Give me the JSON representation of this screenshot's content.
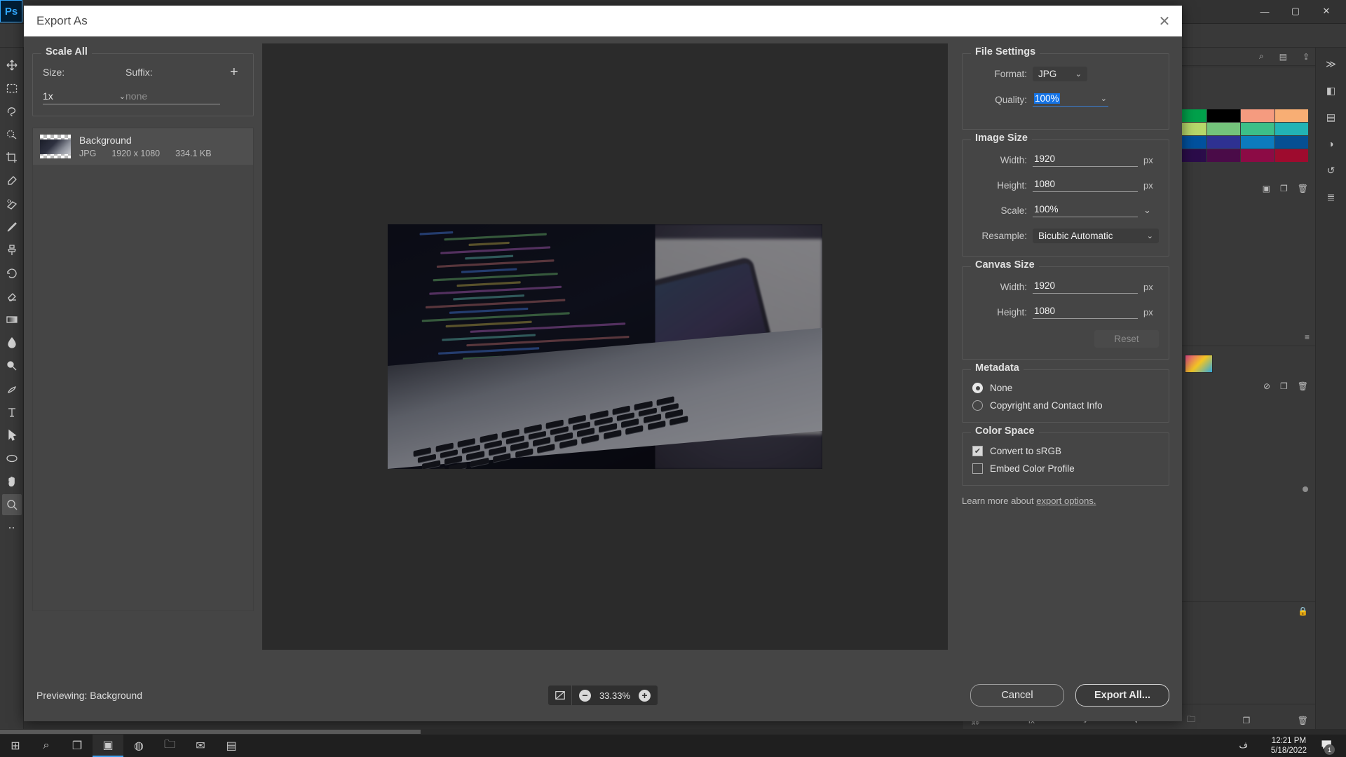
{
  "app": {
    "logo_text": "Ps",
    "window_controls": {
      "minimize": "—",
      "maximize": "▢",
      "close": "✕"
    }
  },
  "dialog": {
    "title": "Export As",
    "close_icon": "✕",
    "scale_all": {
      "legend": "Scale All",
      "size_label": "Size:",
      "size_value": "1x",
      "suffix_label": "Suffix:",
      "suffix_placeholder": "none",
      "add_label": "+"
    },
    "assets": [
      {
        "name": "Background",
        "format": "JPG",
        "dimensions": "1920 x 1080",
        "filesize": "334.1 KB"
      }
    ],
    "file_settings": {
      "legend": "File Settings",
      "format_label": "Format:",
      "format_value": "JPG",
      "quality_label": "Quality:",
      "quality_value": "100%"
    },
    "image_size": {
      "legend": "Image Size",
      "width_label": "Width:",
      "width_value": "1920",
      "width_unit": "px",
      "height_label": "Height:",
      "height_value": "1080",
      "height_unit": "px",
      "scale_label": "Scale:",
      "scale_value": "100%",
      "resample_label": "Resample:",
      "resample_value": "Bicubic Automatic"
    },
    "canvas_size": {
      "legend": "Canvas Size",
      "width_label": "Width:",
      "width_value": "1920",
      "width_unit": "px",
      "height_label": "Height:",
      "height_value": "1080",
      "height_unit": "px",
      "reset_label": "Reset"
    },
    "metadata": {
      "legend": "Metadata",
      "option_none": "None",
      "option_copyright": "Copyright and Contact Info",
      "selected": "None"
    },
    "color_space": {
      "legend": "Color Space",
      "convert_label": "Convert to sRGB",
      "convert_checked": true,
      "embed_label": "Embed Color Profile",
      "embed_checked": false
    },
    "learn_more": {
      "prefix": "Learn more about ",
      "link_text": "export options."
    },
    "footer": {
      "previewing_label": "Previewing:",
      "previewing_value": "Background",
      "zoom_value": "33.33%",
      "zoom_out": "−",
      "zoom_in": "+",
      "cancel_label": "Cancel",
      "export_label": "Export All..."
    }
  },
  "taskbar": {
    "time": "12:21 PM",
    "date": "5/18/2022",
    "language": "ف",
    "notification_count": "1"
  },
  "colors": {
    "accent_blue": "#1473e6",
    "dialog_bg": "#454545",
    "titlebar_bg": "#ffffff",
    "canvas_bg": "#2b2b2b",
    "app_bg": "#393939"
  },
  "swatches": {
    "strip": [
      "#ffffff",
      "#2b2b2b",
      "#76c442",
      "#ffffff"
    ],
    "grid": [
      "#c9c9c9",
      "#b4b4b4",
      "#a0a0a0",
      "#8e8e8e",
      "#e32119",
      "#f2e500",
      "#00a14b",
      "#000000",
      "#f59b7f",
      "#f8ae74",
      "#fbc78d",
      "#fdf0a0",
      "#bfdd8f",
      "#a6d6a0",
      "#f7b05b",
      "#fbe45e",
      "#b6d86a",
      "#74c37b",
      "#3cbf88",
      "#22b3b5",
      "#16b1ea",
      "#3bb54a",
      "#00a153",
      "#03aaa5",
      "#00a0e4",
      "#0070c0",
      "#00519e",
      "#2e3192",
      "#0c7bbd",
      "#064f93",
      "#00316d",
      "#1a1260",
      "#3f1b6e",
      "#6a0f6d",
      "#b3006b",
      "#100a40",
      "#2b0c4a",
      "#4a0b48",
      "#8c0b45",
      "#9e0b2e",
      "#d7c0a4",
      "#a08c72"
    ]
  }
}
